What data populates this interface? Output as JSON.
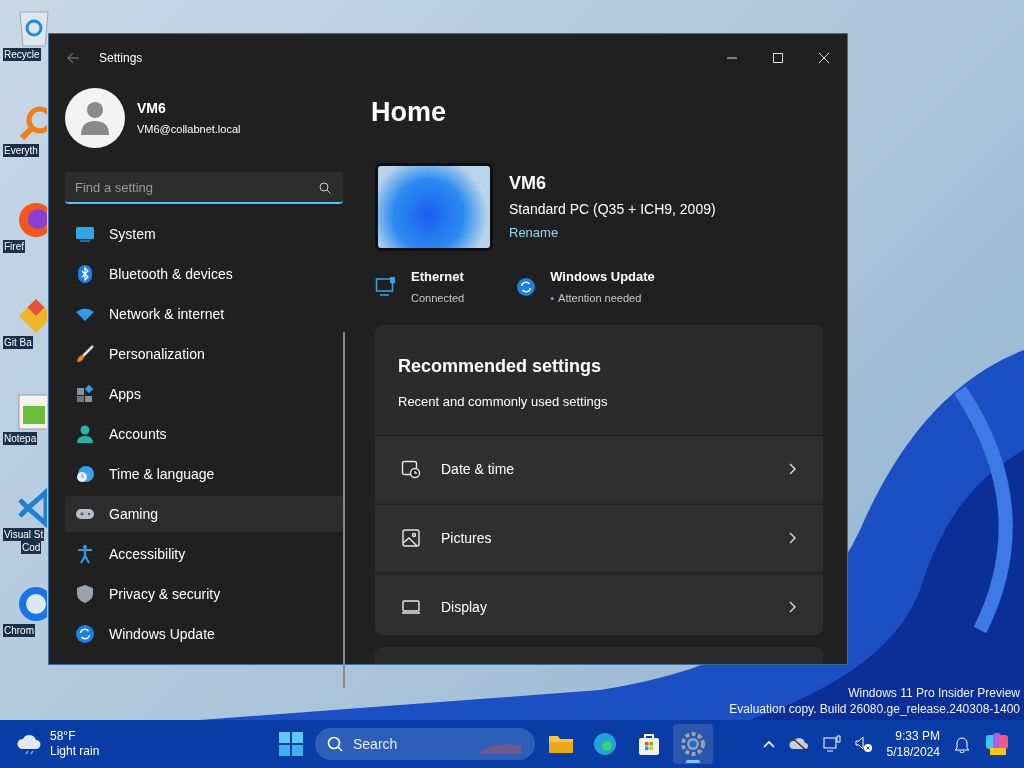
{
  "desktop": {
    "icons": [
      {
        "kind": "recycle",
        "lines": [
          "Recycle"
        ]
      },
      {
        "kind": "search",
        "lines": [
          "Everyth"
        ]
      },
      {
        "kind": "browser",
        "lines": [
          "Firef"
        ]
      },
      {
        "kind": "git",
        "lines": [
          "Git Ba"
        ]
      },
      {
        "kind": "notepad",
        "lines": [
          "Notepa"
        ]
      },
      {
        "kind": "code",
        "lines": [
          "Visual St",
          "Cod"
        ]
      },
      {
        "kind": "chrome",
        "lines": [
          "Chrom"
        ]
      }
    ],
    "watermark": [
      "Windows 11 Pro Insider Preview",
      "Evaluation copy. Build 26080.ge_release.240308-1400"
    ]
  },
  "window": {
    "title": "Settings",
    "user": {
      "name": "VM6",
      "email": "VM6@collabnet.local"
    },
    "search": {
      "placeholder": "Find a setting"
    },
    "nav": [
      {
        "kind": "system",
        "label": "System",
        "selected": false
      },
      {
        "kind": "bluetooth",
        "label": "Bluetooth & devices",
        "selected": false
      },
      {
        "kind": "network",
        "label": "Network & internet",
        "selected": false
      },
      {
        "kind": "brush",
        "label": "Personalization",
        "selected": false
      },
      {
        "kind": "apps",
        "label": "Apps",
        "selected": false
      },
      {
        "kind": "person",
        "label": "Accounts",
        "selected": false
      },
      {
        "kind": "time",
        "label": "Time & language",
        "selected": false
      },
      {
        "kind": "gamepad",
        "label": "Gaming",
        "selected": true
      },
      {
        "kind": "access",
        "label": "Accessibility",
        "selected": false
      },
      {
        "kind": "shield",
        "label": "Privacy & security",
        "selected": false
      },
      {
        "kind": "update",
        "label": "Windows Update",
        "selected": false
      }
    ],
    "page_title": "Home",
    "device": {
      "name": "VM6",
      "model": "Standard PC (Q35 + ICH9, 2009)",
      "rename": "Rename"
    },
    "status": [
      {
        "kind": "ethernet",
        "title": "Ethernet",
        "detail": "Connected"
      },
      {
        "kind": "update",
        "title": "Windows Update",
        "bullet": "•",
        "detail": "Attention needed"
      }
    ],
    "recommended": {
      "title": "Recommended settings",
      "subtitle": "Recent and commonly used settings",
      "items": [
        {
          "kind": "clock",
          "label": "Date & time"
        },
        {
          "kind": "picture",
          "label": "Pictures"
        },
        {
          "kind": "display",
          "label": "Display"
        }
      ]
    }
  },
  "taskbar": {
    "weather": {
      "temp": "58°F",
      "condition": "Light rain"
    },
    "search": {
      "placeholder": "Search"
    },
    "apps": [
      {
        "kind": "folder",
        "active": false
      },
      {
        "kind": "edge",
        "active": false
      },
      {
        "kind": "store",
        "active": false
      },
      {
        "kind": "gear",
        "active": true
      }
    ],
    "time": "9:33 PM",
    "date": "5/18/2024"
  }
}
